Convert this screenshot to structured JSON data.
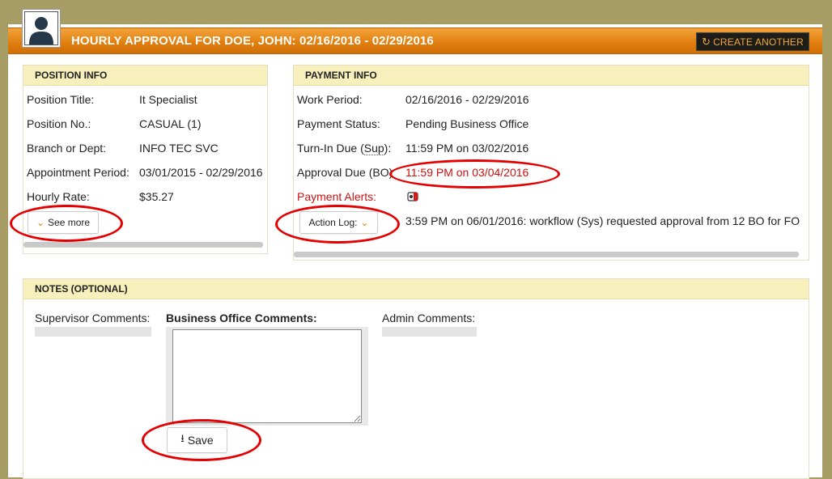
{
  "page": {
    "header_title": "HOURLY APPROVAL FOR DOE, JOHN: 02/16/2016 - 02/29/2016",
    "create_another_label": "CREATE ANOTHER"
  },
  "position_info": {
    "heading": "POSITION INFO",
    "rows": [
      {
        "label": "Position Title:",
        "value": "It Specialist"
      },
      {
        "label": "Position No.:",
        "value": "CASUAL (1)"
      },
      {
        "label": "Branch or Dept:",
        "value": "INFO TEC SVC"
      },
      {
        "label": "Appointment Period:",
        "value": "03/01/2015 - 02/29/2016"
      },
      {
        "label": "Hourly Rate:",
        "value": "$35.27"
      }
    ],
    "see_more_label": "See more"
  },
  "payment_info": {
    "heading": "PAYMENT INFO",
    "work_period_label": "Work Period:",
    "work_period_value": "02/16/2016 - 02/29/2016",
    "payment_status_label": "Payment Status:",
    "payment_status_value": "Pending Business Office",
    "turn_in_label_prefix": "Turn-In Due (",
    "turn_in_label_abbr": "Sup",
    "turn_in_label_suffix": "):",
    "turn_in_value": "11:59 PM on 03/02/2016",
    "approval_label_prefix": "Approval Due (",
    "approval_label_abbr": "BO",
    "approval_label_suffix": "):",
    "approval_value": "11:59 PM on 03/04/2016",
    "alerts_label": "Payment Alerts:",
    "action_log_label": "Action Log:",
    "action_log_prefix": "3:59 PM on 06/01/2016: workflow (",
    "action_log_abbr": "Sys",
    "action_log_suffix": ") requested approval from 12 BO for FO"
  },
  "notes": {
    "heading": "NOTES (OPTIONAL)",
    "supervisor_label": "Supervisor Comments:",
    "business_office_label": "Business Office Comments:",
    "admin_label": "Admin Comments:",
    "save_label": "Save"
  },
  "colors": {
    "header_orange": "#e07d0e",
    "section_head": "#f7f0bc",
    "alert_red": "#cc1111",
    "annotation_red": "#e40000"
  }
}
